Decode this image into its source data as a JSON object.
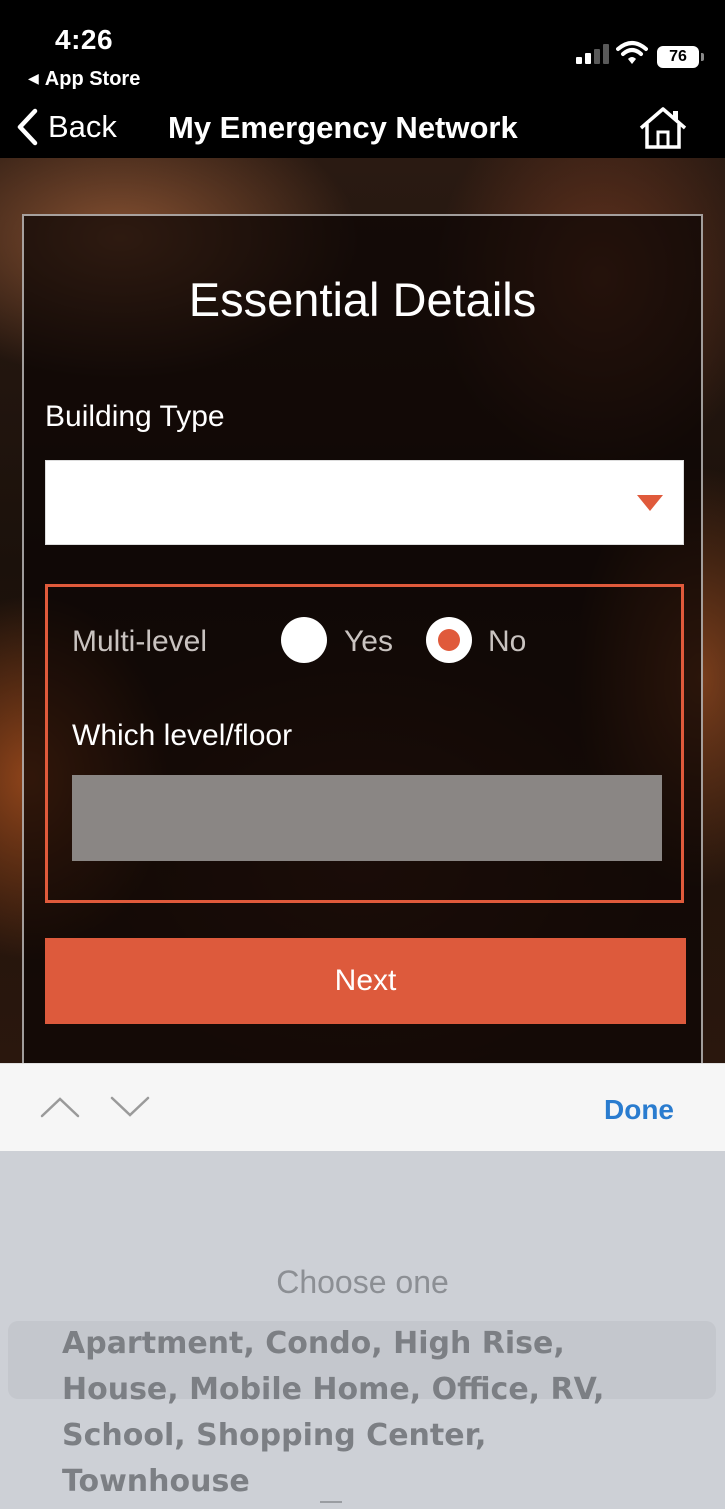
{
  "status_bar": {
    "time": "4:26",
    "back_to_app": "App Store",
    "battery": "76"
  },
  "nav": {
    "back_label": "Back",
    "title": "My Emergency Network"
  },
  "form": {
    "title": "Essential Details",
    "building_type_label": "Building Type",
    "building_type_value": "",
    "multi_level_label": "Multi-level",
    "options": {
      "yes": "Yes",
      "no": "No",
      "selected": "No"
    },
    "level_label": "Which level/floor",
    "level_value": "",
    "next_label": "Next"
  },
  "keyboard_accessory": {
    "done_label": "Done"
  },
  "picker": {
    "placeholder": "Choose one",
    "options_text": "Apartment, Condo, High Rise, House, Mobile Home, Office, RV, School, Shopping Center, Townhouse"
  },
  "colors": {
    "accent": "#dd5a3c",
    "link": "#2a7ccf"
  }
}
